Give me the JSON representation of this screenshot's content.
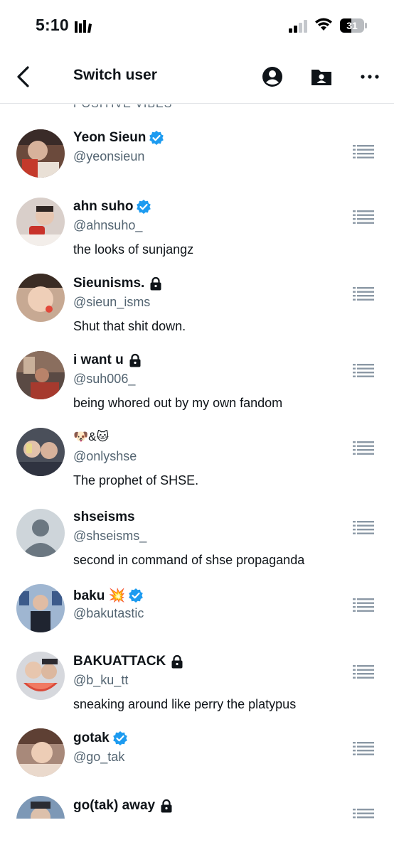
{
  "status": {
    "time": "5:10",
    "battery": "31"
  },
  "header": {
    "title": "Switch user"
  },
  "list": {
    "cut_off_text": "POSITIVE VIBES",
    "accounts": [
      {
        "name": "Yeon Sieun",
        "handle": "@yeonsieun",
        "bio": "",
        "badge": "verified"
      },
      {
        "name": "ahn suho",
        "handle": "@ahnsuho_",
        "bio": "the looks of sunjangz",
        "badge": "verified"
      },
      {
        "name": "Sieunisms.",
        "handle": "@sieun_isms",
        "bio": "Shut that shit down.",
        "badge": "lock"
      },
      {
        "name": "i want u",
        "handle": "@suh006_",
        "bio": "being whored out by my own fandom",
        "badge": "lock"
      },
      {
        "name": "🐶&🐱",
        "handle": "@onlyshse",
        "bio": "The prophet of SHSE.",
        "badge": ""
      },
      {
        "name": "shseisms",
        "handle": "@shseisms_",
        "bio": "second in command of shse propaganda",
        "badge": ""
      },
      {
        "name": "baku 💥",
        "handle": "@bakutastic",
        "bio": "",
        "badge": "verified"
      },
      {
        "name": "BAKUATTACK",
        "handle": "@b_ku_tt",
        "bio": "sneaking around like perry the platypus",
        "badge": "lock"
      },
      {
        "name": "gotak",
        "handle": "@go_tak",
        "bio": "",
        "badge": "verified"
      },
      {
        "name": "go(tak) away",
        "handle": "",
        "bio": "",
        "badge": "lock"
      }
    ]
  },
  "colors": {
    "verified": "#1d9bf0",
    "secondary_text": "#536471",
    "divider": "#e3e5e8"
  }
}
